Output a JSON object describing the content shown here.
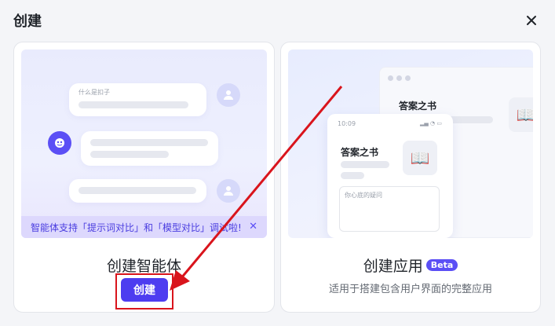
{
  "dialog": {
    "title": "创建",
    "close_icon": "close-icon"
  },
  "agent_card": {
    "title": "创建智能体",
    "button_label": "创建",
    "banner_text": "智能体支持「提示词对比」和「模型对比」调试啦!",
    "banner_close": "✕",
    "question_label": "什么是扣子"
  },
  "app_card": {
    "title": "创建应用",
    "badge": "Beta",
    "subtitle": "适用于搭建包含用户界面的完整应用",
    "app_name": "答案之书",
    "phone_time": "10:09",
    "input_placeholder": "你心底的疑问"
  },
  "colors": {
    "accent": "#4d3df0",
    "annotation_red": "#d9141c"
  }
}
